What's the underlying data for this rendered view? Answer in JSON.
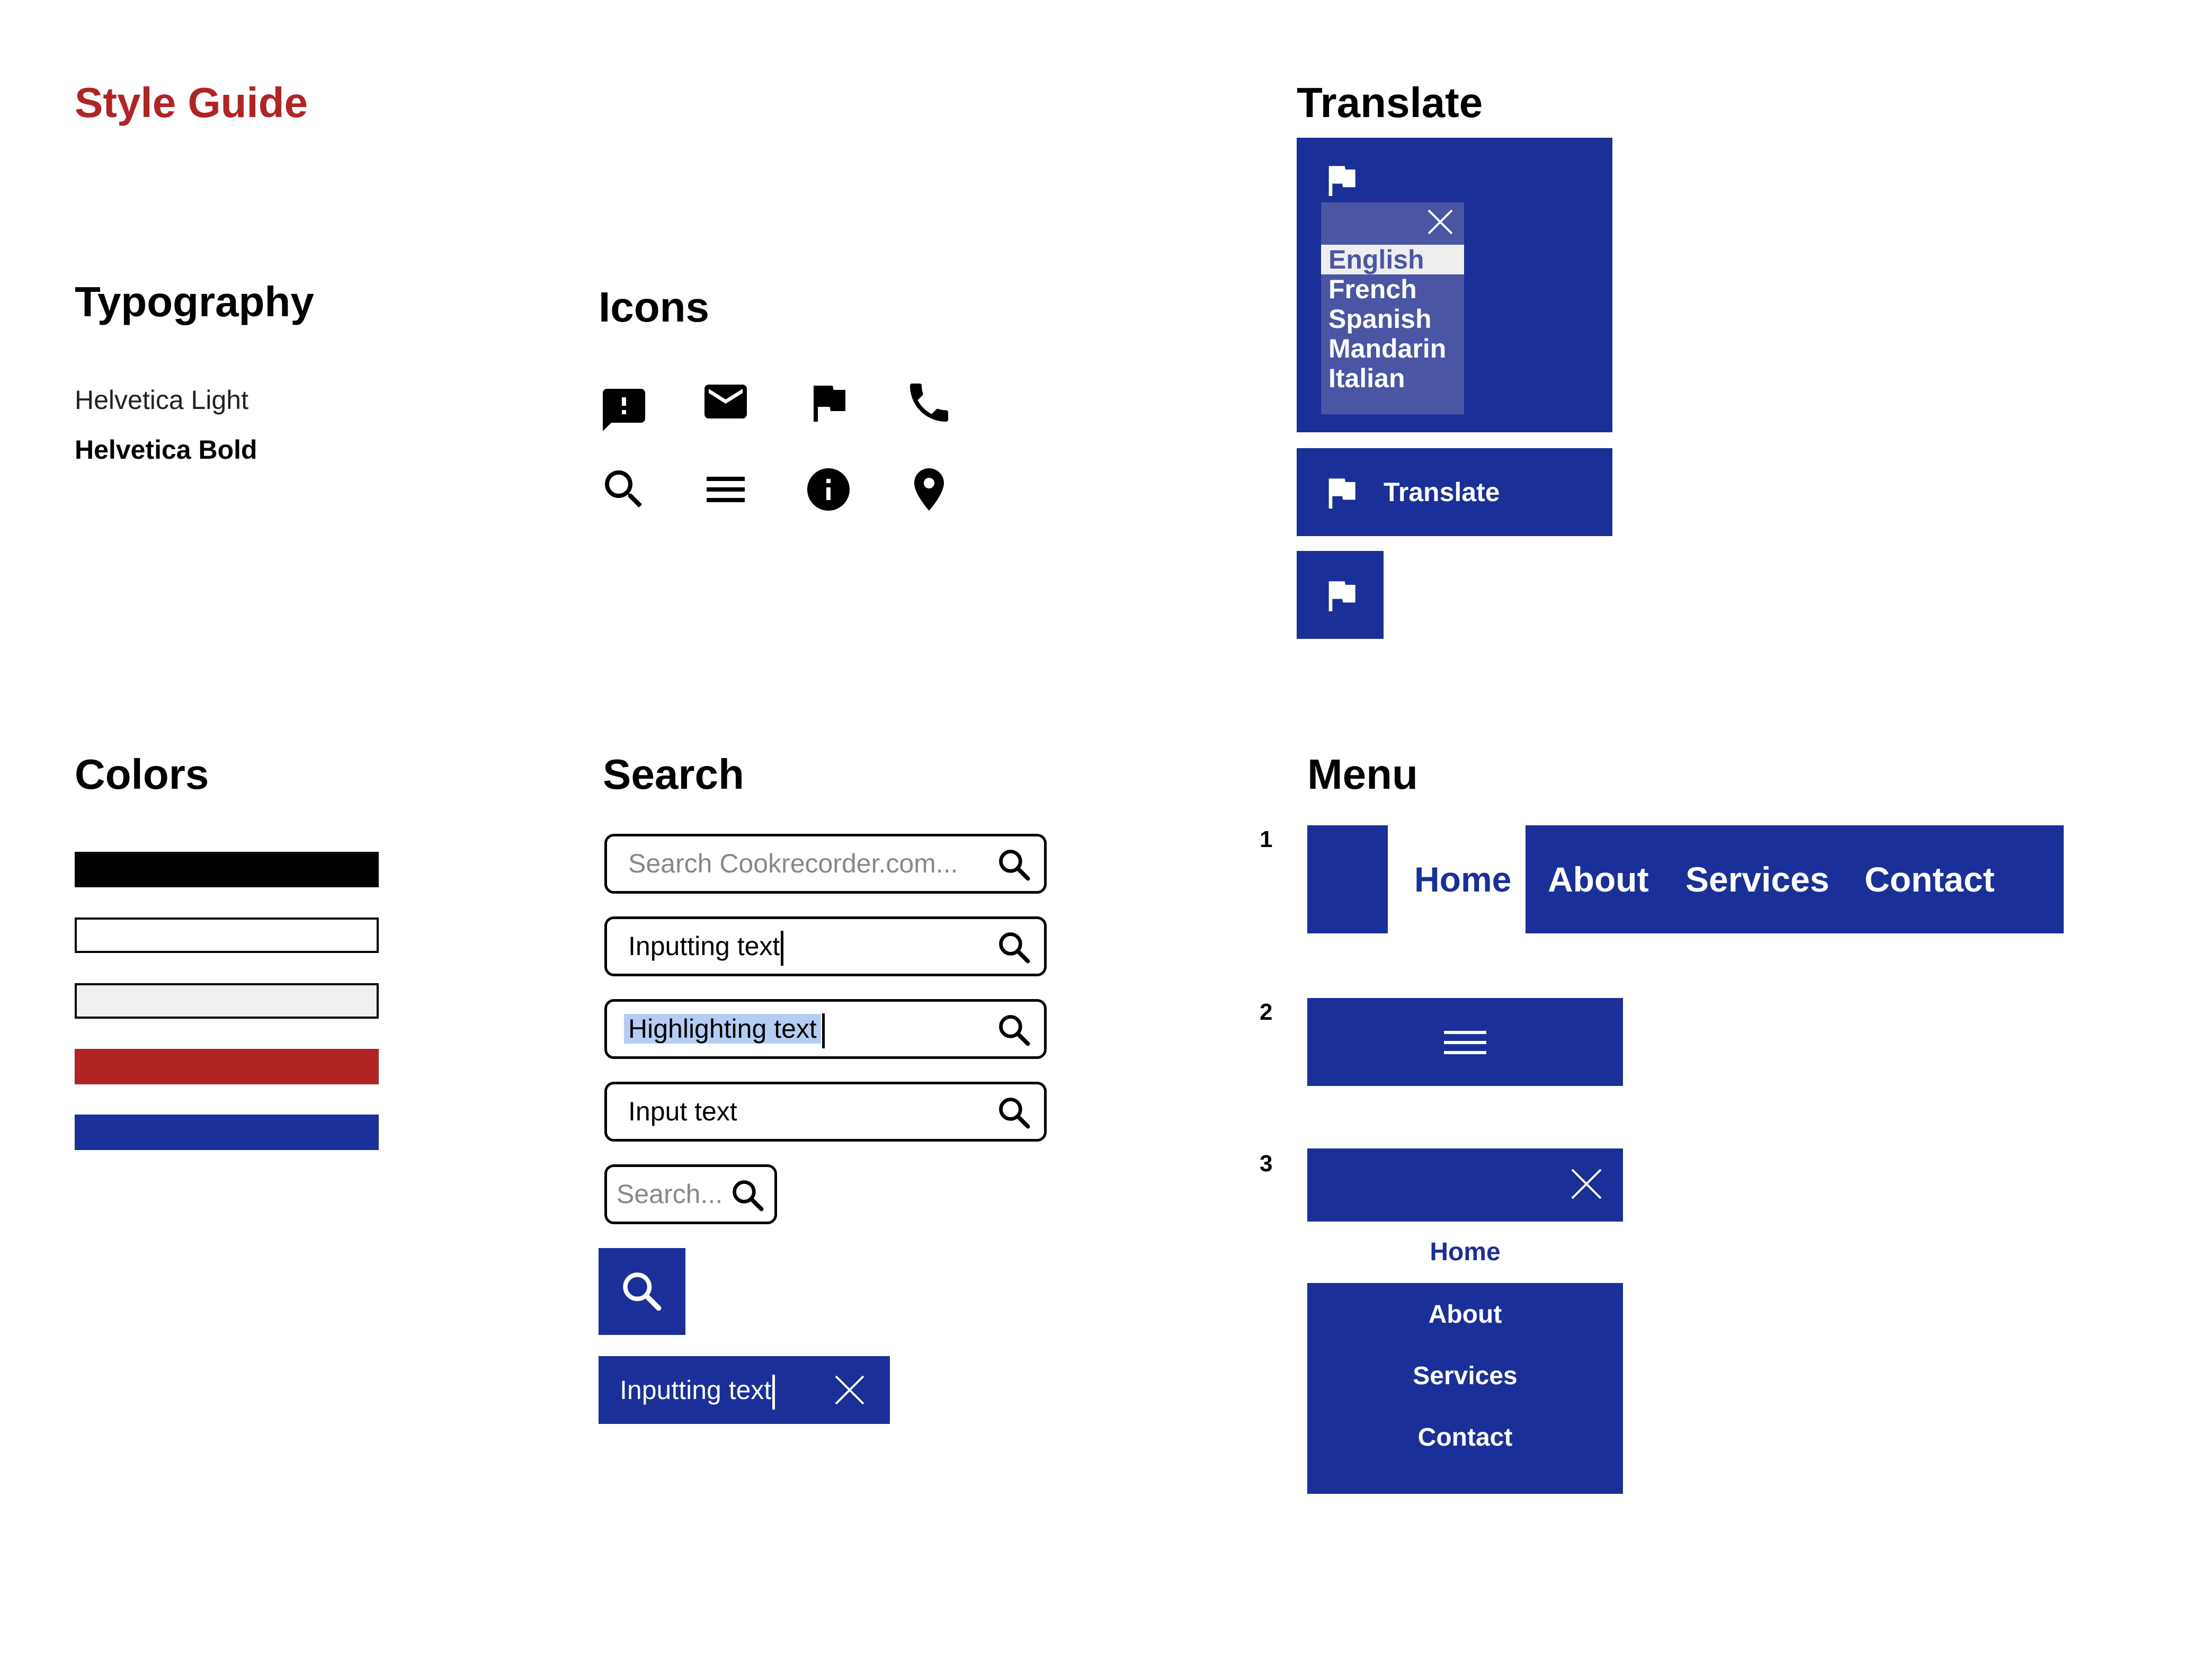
{
  "page": {
    "title": "Style Guide",
    "title_color": "#b02424"
  },
  "typography": {
    "heading": "Typography",
    "light_sample": "Helvetica Light",
    "bold_sample": "Helvetica Bold"
  },
  "icons": {
    "heading": "Icons",
    "items": [
      "feedback-icon",
      "mail-icon",
      "flag-icon",
      "phone-icon",
      "search-icon",
      "menu-icon",
      "info-icon",
      "location-pin-icon"
    ]
  },
  "colors": {
    "heading": "Colors",
    "swatches": [
      "#000000",
      "#ffffff",
      "#f0f0f0",
      "#b02424",
      "#1a2f97"
    ]
  },
  "search": {
    "heading": "Search",
    "placeholder_full": "Search Cookrecorder.com...",
    "inputting": "Inputting text",
    "highlighting": "Highlighting text",
    "input": "Input text",
    "placeholder_short": "Search...",
    "blue_inputting": "Inputting text"
  },
  "translate": {
    "heading": "Translate",
    "languages": [
      "English",
      "French",
      "Spanish",
      "Mandarin",
      "Italian"
    ],
    "selected": "English",
    "button_label": "Translate"
  },
  "menu": {
    "heading": "Menu",
    "variant_numbers": [
      "1",
      "2",
      "3"
    ],
    "items": [
      "Home",
      "About",
      "Services",
      "Contact"
    ],
    "accent": "#1a2f97"
  }
}
